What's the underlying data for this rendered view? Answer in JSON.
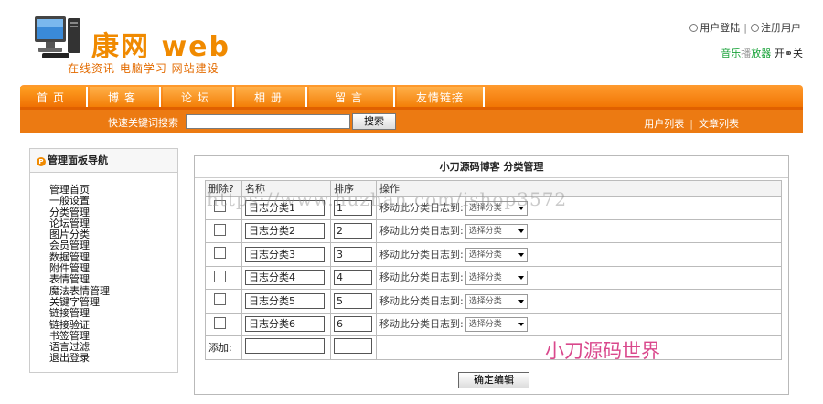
{
  "header": {
    "brand_cn": "康网",
    "brand_web": "web",
    "slogan": "在线资讯  电脑学习  网站建设",
    "login_link": "用户登陆",
    "register_link": "注册用户",
    "music_part1": "音乐",
    "music_part2": "播",
    "music_part3": "放器",
    "music_on": "开",
    "music_off": "关"
  },
  "nav": {
    "items": [
      {
        "label": "首页"
      },
      {
        "label": "博客"
      },
      {
        "label": "论坛"
      },
      {
        "label": "相册"
      },
      {
        "label": "留言"
      },
      {
        "label": "友情链接"
      }
    ],
    "active_index": 0
  },
  "search": {
    "label": "快速关键词搜索",
    "value": "",
    "button": "搜索"
  },
  "right_links": {
    "user_list": "用户列表",
    "article_list": "文章列表"
  },
  "sidebar": {
    "title": "管理面板导航",
    "items": [
      "管理首页",
      "一般设置",
      "分类管理",
      "论坛管理",
      "图片分类",
      "会员管理",
      "数据管理",
      "附件管理",
      "表情管理",
      "魔法表情管理",
      "关键字管理",
      "链接管理",
      "链接验证",
      "书签管理",
      "语言过滤",
      "退出登录"
    ]
  },
  "panel": {
    "title": "小刀源码博客 分类管理",
    "headers": {
      "delete": "删除?",
      "name": "名称",
      "order": "排序",
      "action": "操作"
    },
    "rows": [
      {
        "name": "日志分类1",
        "order": "1"
      },
      {
        "name": "日志分类2",
        "order": "2"
      },
      {
        "name": "日志分类3",
        "order": "3"
      },
      {
        "name": "日志分类4",
        "order": "4"
      },
      {
        "name": "日志分类5",
        "order": "5"
      },
      {
        "name": "日志分类6",
        "order": "6"
      }
    ],
    "move_label": "移动此分类日志到:",
    "select_value": "选择分类",
    "add_label": "添加:",
    "submit": "确定编辑"
  },
  "watermarks": {
    "url": "https://www.huzhan.com/ishop3572",
    "brand": "小刀源码世界"
  },
  "colors": {
    "nav_orange": "#f07200",
    "brand_orange": "#f08a00",
    "watermark_pink": "#d22878"
  }
}
